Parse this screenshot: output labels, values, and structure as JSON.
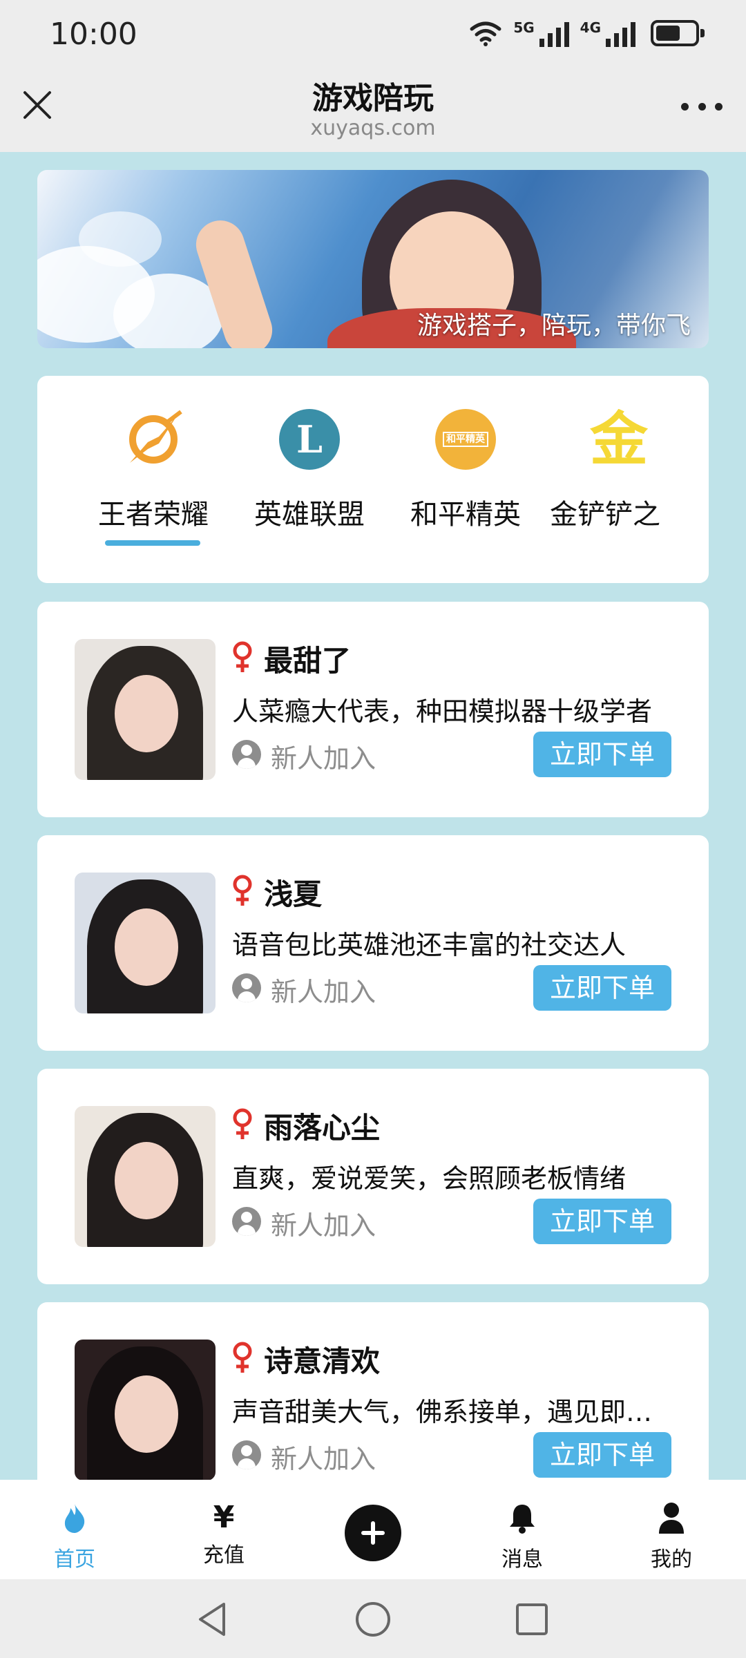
{
  "status_bar": {
    "time": "10:00",
    "network_1": "5G",
    "network_2": "4G"
  },
  "header": {
    "title": "游戏陪玩",
    "subtitle": "xuyaqs.com",
    "close_icon": "close-icon",
    "more_icon": "more-dots-icon"
  },
  "banner": {
    "slogan": "游戏搭子，陪玩，带你飞"
  },
  "games": [
    {
      "name": "王者荣耀",
      "icon": "wzry-icon",
      "selected": true
    },
    {
      "name": "英雄联盟",
      "icon": "lol-icon",
      "selected": false
    },
    {
      "name": "和平精英",
      "icon": "hpjy-icon",
      "selected": false
    },
    {
      "name": "金铲铲之",
      "icon": "jcc-icon",
      "selected": false
    }
  ],
  "game_icon_text": {
    "lol": "L",
    "hpjy": "和平精英",
    "jcc": "金"
  },
  "players": [
    {
      "name": "最甜了",
      "gender": "female",
      "description": "人菜瘾大代表，种田模拟器十级学者",
      "status": "新人加入",
      "button": "立即下单"
    },
    {
      "name": "浅夏",
      "gender": "female",
      "description": "语音包比英雄池还丰富的社交达人",
      "status": "新人加入",
      "button": "立即下单"
    },
    {
      "name": "雨落心尘",
      "gender": "female",
      "description": "直爽，爱说爱笑，会照顾老板情绪",
      "status": "新人加入",
      "button": "立即下单"
    },
    {
      "name": "诗意清欢",
      "gender": "female",
      "description": "声音甜美大气，佛系接单，遇见即是缘",
      "status": "新人加入",
      "button": "立即下单"
    }
  ],
  "bottom_nav": [
    {
      "label": "首页",
      "icon": "flame-icon",
      "active": true
    },
    {
      "label": "充值",
      "icon": "yen-icon",
      "active": false
    },
    {
      "label": "",
      "icon": "plus-icon",
      "active": false
    },
    {
      "label": "消息",
      "icon": "bell-icon",
      "active": false
    },
    {
      "label": "我的",
      "icon": "person-icon",
      "active": false
    }
  ],
  "bottom_nav_yen_glyph": "¥",
  "colors": {
    "accent": "#50b4e6",
    "active_tab": "#3aa4e0",
    "page_bg": "#bfe3e9",
    "female": "#e0332c",
    "wzry_orange": "#f0a030",
    "lol_teal": "#3a8fa8",
    "hpjy_yellow": "#f2b33a",
    "jcc_yellow": "#f5d835"
  },
  "system_nav": {
    "back_icon": "back-triangle-icon",
    "home_icon": "home-circle-icon",
    "recents_icon": "recents-square-icon"
  }
}
